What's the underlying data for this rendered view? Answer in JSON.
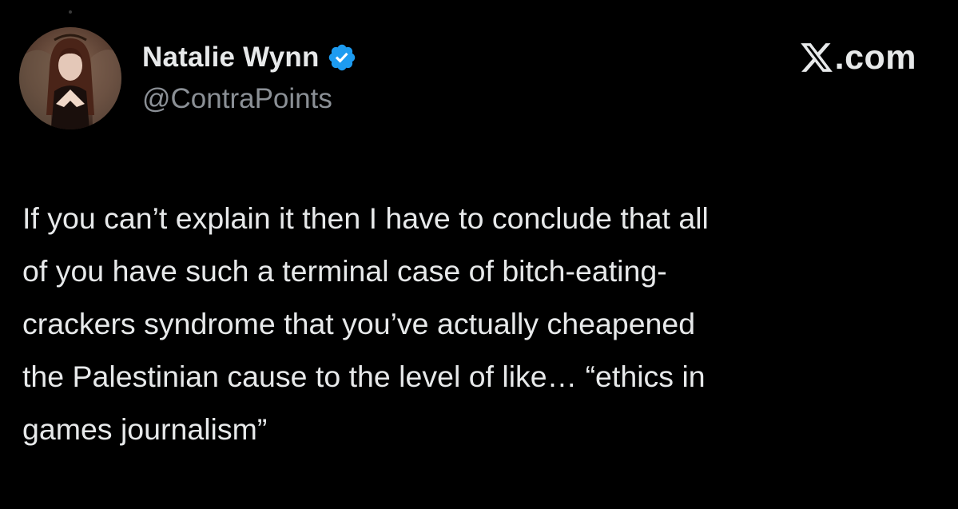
{
  "author": {
    "display_name": "Natalie Wynn",
    "handle": "@ContraPoints",
    "verified_icon": "verified-badge-icon",
    "verified_color": "#1d9bf0"
  },
  "brand": {
    "logo_icon": "x-logo-icon",
    "suffix": ".com"
  },
  "tweet": {
    "lines": [
      "If you can’t explain it then I have to conclude that all",
      "of you have such a terminal case of bitch-eating-",
      "crackers syndrome that you’ve actually cheapened",
      "the Palestinian cause to the level of like… “ethics in",
      "games journalism”"
    ]
  },
  "colors": {
    "background": "#000000",
    "text_primary": "#e7e9ea",
    "text_secondary": "#8b9096"
  }
}
